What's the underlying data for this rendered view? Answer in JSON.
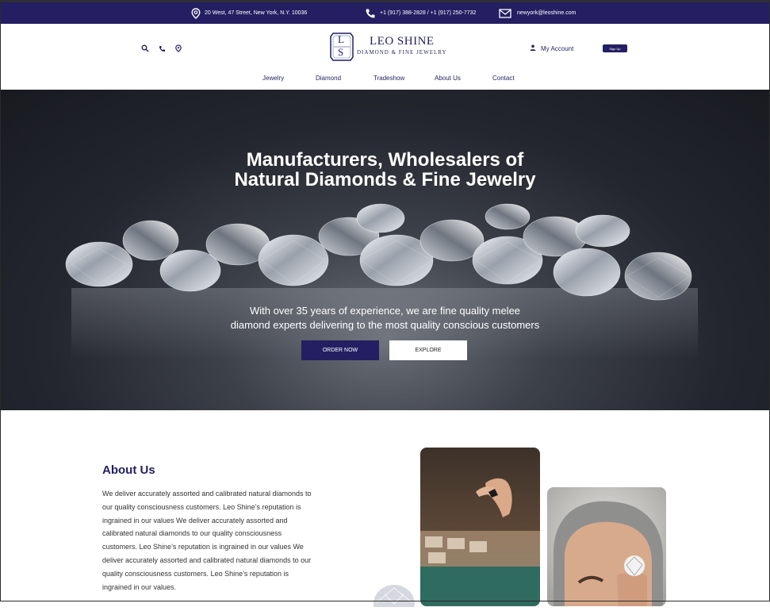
{
  "topbar": {
    "address": "20 West, 47 Street, New York, N.Y. 10036",
    "phone": "+1 (917) 388-2828 / +1 (917) 250-7732",
    "email": "newyork@leoshine.com"
  },
  "header": {
    "logo_initials_top": "L",
    "logo_initials_bottom": "S",
    "logo_name": "LEO SHINE",
    "logo_tagline": "DIAMOND & FINE JEWELRY",
    "account_label": "My Account",
    "signup_label": "Sign Up",
    "icons": [
      "search-icon",
      "phone-icon",
      "location-icon",
      "user-icon"
    ]
  },
  "nav": {
    "items": [
      {
        "label": "Jewelry"
      },
      {
        "label": "Diamond"
      },
      {
        "label": "Tradeshow"
      },
      {
        "label": "About Us"
      },
      {
        "label": "Contact"
      }
    ]
  },
  "hero": {
    "title_line1": "Manufacturers, Wholesalers of",
    "title_line2": "Natural Diamonds & Fine Jewelry",
    "subtitle_line1": "With over 35 years of experience, we are fine quality melee",
    "subtitle_line2": "diamond experts delivering to the most quality conscious customers",
    "order_label": "ORDER NOW",
    "explore_label": "EXPLORE"
  },
  "about": {
    "title": "About Us",
    "body": "We deliver accurately assorted and calibrated natural diamonds to our quality consciousness customers. Leo Shine’s reputation is ingrained in our values We deliver accurately assorted and calibrated natural diamonds to our quality consciousness customers. Leo Shine’s reputation is ingrained in our values We deliver accurately assorted and calibrated natural diamonds to our quality consciousness customers. Leo Shine’s reputation is ingrained in our values."
  },
  "colors": {
    "brand": "#231f62",
    "hero_dark": "#1c1e25"
  }
}
